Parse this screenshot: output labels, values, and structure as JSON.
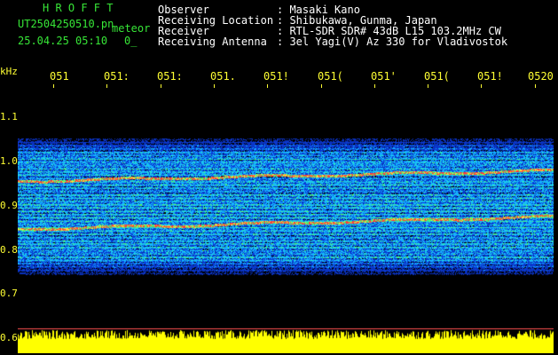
{
  "header": {
    "logo": "H R O F F T",
    "filename": "UT2504250510.pn",
    "meteor_label": "meteor",
    "datetime": "25.04.25 05:10",
    "extra": "0_"
  },
  "info": [
    {
      "label": "Observer",
      "value": ": Masaki Kano"
    },
    {
      "label": "Receiving Location",
      "value": ": Shibukawa, Gunma, Japan"
    },
    {
      "label": "Receiver",
      "value": ": RTL-SDR SDR# 43dB L15 103.2MHz CW"
    },
    {
      "label": "Receiving Antenna",
      "value": ": 3el Yagi(V) Az 330 for Vladivostok"
    }
  ],
  "axis": {
    "unit": "kHz",
    "y_ticks": [
      "1.1",
      "1.0",
      "0.9",
      "0.8",
      "0.7",
      "0.6"
    ],
    "x_ticks": [
      "051",
      "051:",
      "051:",
      "051.",
      "051!",
      "051(",
      "051'",
      "051(",
      "051!",
      "0520"
    ]
  },
  "colors": {
    "background": "#000000",
    "logo": "#37e637",
    "info": "#ffffff",
    "axis": "#ffff33",
    "spectrum_low": "#0a1a8a",
    "spectrum_mid": "#2f7fff",
    "spectrum_high": "#33ff66",
    "spectrum_peak": "#ff3030",
    "noise_floor": "#ffff00"
  }
}
